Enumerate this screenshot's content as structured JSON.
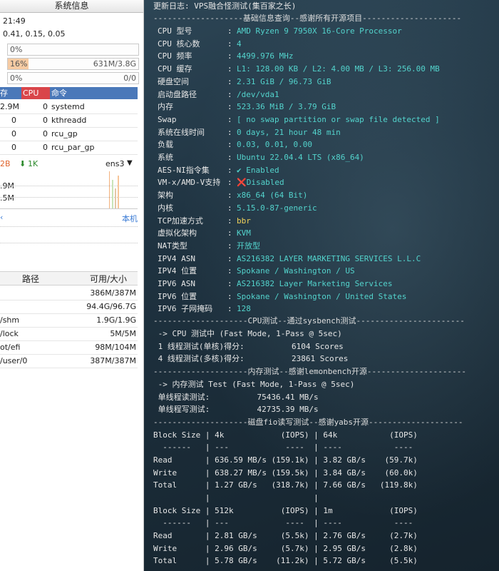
{
  "system_panel": {
    "title": "系统信息",
    "time": "21:49",
    "load": "0.41, 0.15, 0.05",
    "cpu_bar": {
      "label": "0%",
      "fill": 0.0
    },
    "mem_bar": {
      "label": "16%",
      "value": "631M/3.8G",
      "fill": 0.16
    },
    "swap_bar": {
      "label": "0%",
      "value": "0/0",
      "fill": 0.0
    }
  },
  "process_table": {
    "headers": [
      "存",
      "CPU",
      "命令"
    ],
    "rows": [
      {
        "mem": "2.9M",
        "cpu": "0",
        "cmd": "systemd"
      },
      {
        "mem": "0",
        "cpu": "0",
        "cmd": "kthreadd"
      },
      {
        "mem": "0",
        "cpu": "0",
        "cmd": "rcu_gp"
      },
      {
        "mem": "0",
        "cpu": "0",
        "cmd": "rcu_par_gp"
      }
    ]
  },
  "network": {
    "up": "2B",
    "down_arrow": "⬇",
    "down": "1K",
    "interface": "ens3",
    "chart_labels": [
      ".9M",
      ".5M"
    ],
    "local_link": "本机"
  },
  "mounts": {
    "headers": [
      "路径",
      "可用/大小"
    ],
    "rows": [
      {
        "path": "",
        "size": "386M/387M"
      },
      {
        "path": "",
        "size": "94.4G/96.7G"
      },
      {
        "path": "/shm",
        "size": "1.9G/1.9G"
      },
      {
        "path": "/lock",
        "size": "5M/5M"
      },
      {
        "path": "ot/efi",
        "size": "98M/104M"
      },
      {
        "path": "/user/0",
        "size": "387M/387M"
      }
    ]
  },
  "colors": {
    "accent_blue": "#4a78b9",
    "cpu_red": "#d9454a",
    "terminal_cyan": "#53d3cc",
    "terminal_yellow": "#f0d15a",
    "mem_fill": "#f6cba3"
  },
  "terminal": {
    "title_line": "更新日志: VPS融合怪测试(集百家之长)",
    "sep_basic": "-------------------基础信息查询--感谢所有开源项目---------------------",
    "basic": [
      {
        "label": "CPU 型号",
        "value": "AMD Ryzen 9 7950X 16-Core Processor"
      },
      {
        "label": "CPU 核心数",
        "value": "4"
      },
      {
        "label": "CPU 频率",
        "value": "4499.976 MHz"
      },
      {
        "label": "CPU 缓存",
        "value": "L1: 128.00 KB / L2: 4.00 MB / L3: 256.00 MB"
      },
      {
        "label": "硬盘空间",
        "value": "2.31 GiB / 96.73 GiB"
      },
      {
        "label": "启动盘路径",
        "value": "/dev/vda1"
      },
      {
        "label": "内存",
        "value": "523.36 MiB / 3.79 GiB"
      },
      {
        "label": "Swap",
        "value": "[ no swap partition or swap file detected ]"
      },
      {
        "label": "系统在线时间",
        "value": "0 days, 21 hour 48 min"
      },
      {
        "label": "负载",
        "value": "0.03, 0.01, 0.00"
      },
      {
        "label": "系统",
        "value": "Ubuntu 22.04.4 LTS (x86_64)"
      },
      {
        "label": "AES-NI指令集",
        "value": "✔ Enabled"
      },
      {
        "label": "VM-x/AMD-V支持",
        "value": "❌Disabled"
      },
      {
        "label": "架构",
        "value": "x86_64 (64 Bit)"
      },
      {
        "label": "内核",
        "value": "5.15.0-87-generic"
      },
      {
        "label": "TCP加速方式",
        "value": "bbr"
      },
      {
        "label": "虚拟化架构",
        "value": "KVM"
      },
      {
        "label": "NAT类型",
        "value": "开放型"
      },
      {
        "label": "IPV4 ASN",
        "value": "AS216382 LAYER MARKETING SERVICES L.L.C"
      },
      {
        "label": "IPV4 位置",
        "value": "Spokane / Washington / US"
      },
      {
        "label": "IPV6 ASN",
        "value": "AS216382 Layer Marketing Services"
      },
      {
        "label": "IPV6 位置",
        "value": "Spokane / Washington / United States"
      },
      {
        "label": "IPV6 子网掩码",
        "value": "128"
      }
    ],
    "sep_cpu": "--------------------CPU测试--通过sysbench测试-----------------------",
    "cpu_lines": [
      " -> CPU 测试中 (Fast Mode, 1-Pass @ 5sec)",
      " 1 线程测试(单核)得分:          6104 Scores",
      " 4 线程测试(多核)得分:          23861 Scores"
    ],
    "sep_mem": "--------------------内存测试--感谢lemonbench开源---------------------",
    "mem_lines": [
      " -> 内存测试 Test (Fast Mode, 1-Pass @ 5sec)",
      " 单线程读测试:          75436.41 MB/s",
      " 单线程写测试:          42735.39 MB/s"
    ],
    "sep_disk": "--------------------磁盘fio读写测试--感谢yabs开源--------------------",
    "disk_lines": [
      "Block Size | 4k            (IOPS) | 64k           (IOPS)",
      "  ------   | ---            ----  | ----           ----",
      "Read       | 636.59 MB/s (159.1k) | 3.82 GB/s    (59.7k)",
      "Write      | 638.27 MB/s (159.5k) | 3.84 GB/s    (60.0k)",
      "Total      | 1.27 GB/s   (318.7k) | 7.66 GB/s   (119.8k)",
      "           |                      |",
      "Block Size | 512k          (IOPS) | 1m            (IOPS)",
      "  ------   | ---            ----  | ----           ----",
      "Read       | 2.81 GB/s     (5.5k) | 2.76 GB/s     (2.7k)",
      "Write      | 2.96 GB/s     (5.7k) | 2.95 GB/s     (2.8k)",
      "Total      | 5.78 GB/s    (11.2k) | 5.72 GB/s     (5.5k)"
    ]
  }
}
